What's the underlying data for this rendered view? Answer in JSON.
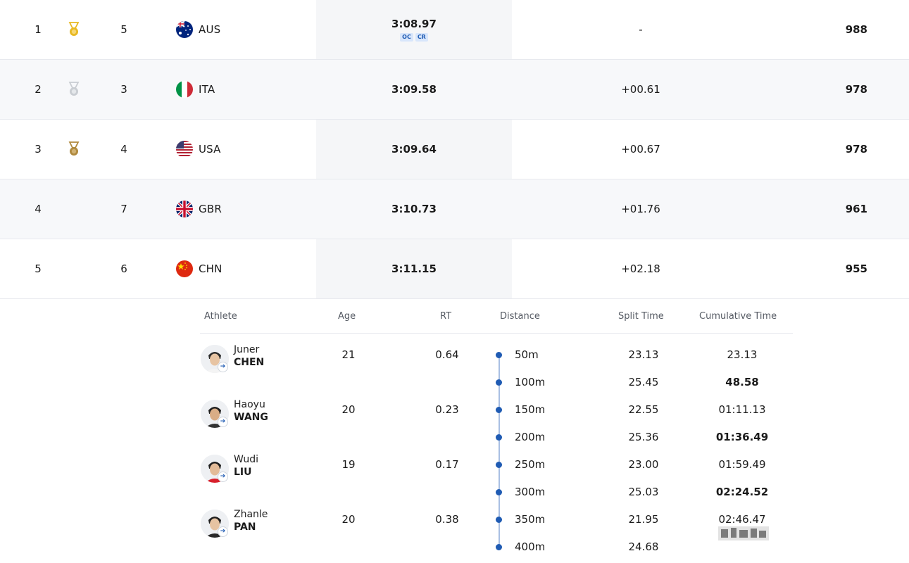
{
  "results": [
    {
      "rank": "1",
      "medal": "gold",
      "lane": "5",
      "country": "AUS",
      "flag": "aus-flag-icon",
      "time": "3:08.97",
      "badges": [
        "OC",
        "CR"
      ],
      "diff": "-",
      "points": "988"
    },
    {
      "rank": "2",
      "medal": "silver",
      "lane": "3",
      "country": "ITA",
      "flag": "ita-flag-icon",
      "time": "3:09.58",
      "badges": [],
      "diff": "+00.61",
      "points": "978"
    },
    {
      "rank": "3",
      "medal": "bronze",
      "lane": "4",
      "country": "USA",
      "flag": "usa-flag-icon",
      "time": "3:09.64",
      "badges": [],
      "diff": "+00.67",
      "points": "978"
    },
    {
      "rank": "4",
      "medal": "",
      "lane": "7",
      "country": "GBR",
      "flag": "gbr-flag-icon",
      "time": "3:10.73",
      "badges": [],
      "diff": "+01.76",
      "points": "961"
    },
    {
      "rank": "5",
      "medal": "",
      "lane": "6",
      "country": "CHN",
      "flag": "chn-flag-icon",
      "time": "3:11.15",
      "badges": [],
      "diff": "+02.18",
      "points": "955"
    }
  ],
  "detail": {
    "headers": {
      "athlete": "Athlete",
      "age": "Age",
      "rt": "RT",
      "distance": "Distance",
      "split": "Split Time",
      "cumulative": "Cumulative Time"
    },
    "athletes": [
      {
        "first": "Juner",
        "last": "CHEN",
        "age": "21",
        "rt": "0.64"
      },
      {
        "first": "Haoyu",
        "last": "WANG",
        "age": "20",
        "rt": "0.23"
      },
      {
        "first": "Wudi",
        "last": "LIU",
        "age": "19",
        "rt": "0.17"
      },
      {
        "first": "Zhanle",
        "last": "PAN",
        "age": "20",
        "rt": "0.38"
      }
    ],
    "splits": [
      {
        "distance": "50m",
        "split": "23.13",
        "cumulative": "23.13",
        "bold": false
      },
      {
        "distance": "100m",
        "split": "25.45",
        "cumulative": "48.58",
        "bold": true
      },
      {
        "distance": "150m",
        "split": "22.55",
        "cumulative": "01:11.13",
        "bold": false
      },
      {
        "distance": "200m",
        "split": "25.36",
        "cumulative": "01:36.49",
        "bold": true
      },
      {
        "distance": "250m",
        "split": "23.00",
        "cumulative": "01:59.49",
        "bold": false
      },
      {
        "distance": "300m",
        "split": "25.03",
        "cumulative": "02:24.52",
        "bold": true
      },
      {
        "distance": "350m",
        "split": "21.95",
        "cumulative": "02:46.47",
        "bold": false
      },
      {
        "distance": "400m",
        "split": "24.68",
        "cumulative": "",
        "bold": true
      }
    ]
  },
  "colors": {
    "gold": "#e8b923",
    "silver": "#c9cdd2",
    "bronze": "#b08a3e",
    "accent": "#1f5bb3"
  }
}
